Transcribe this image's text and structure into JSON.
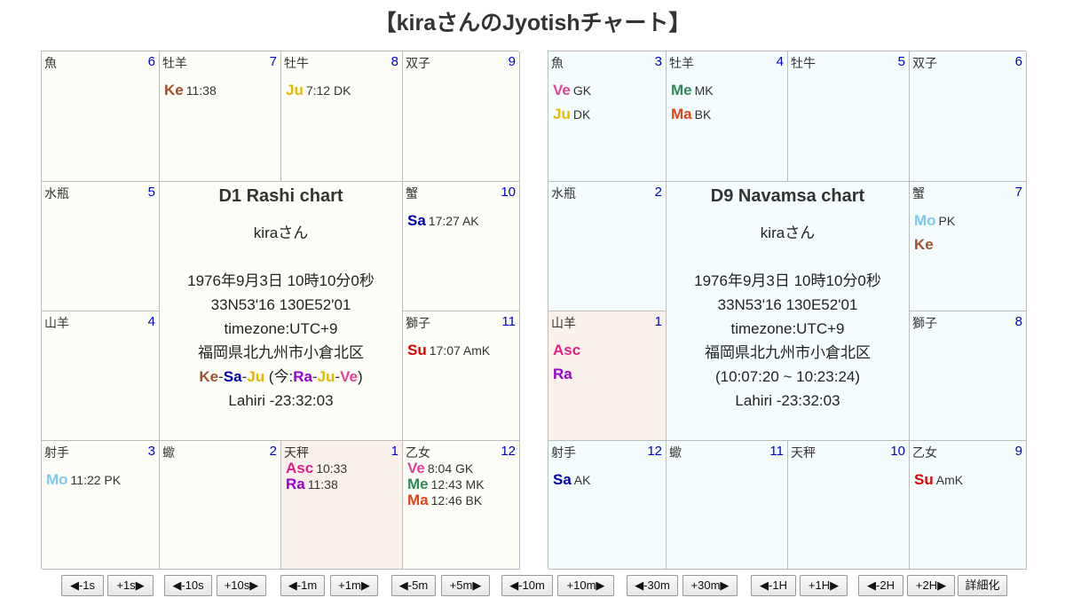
{
  "title": "【kiraさんのJyotishチャート】",
  "charts": [
    {
      "id": "d1",
      "title": "D1 Rashi chart",
      "name": "kiraさん",
      "datetime": "1976年9月3日 10時10分0秒",
      "coords": "33N53'16 130E52'01",
      "timezone": "timezone:UTC+9",
      "place": "福岡県北九州市小倉北区",
      "extra_line": "",
      "dasha": {
        "main": [
          {
            "t": "Ke",
            "c": "#a0522d"
          },
          {
            "t": "-",
            "c": "#333333"
          },
          {
            "t": "Sa",
            "c": "#0000aa"
          },
          {
            "t": "-",
            "c": "#333333"
          },
          {
            "t": "Ju",
            "c": "#e6b800"
          }
        ],
        "now_prefix": " (今:",
        "now": [
          {
            "t": "Ra",
            "c": "#9900cc"
          },
          {
            "t": "-",
            "c": "#333333"
          },
          {
            "t": "Ju",
            "c": "#e6b800"
          },
          {
            "t": "-",
            "c": "#333333"
          },
          {
            "t": "Ve",
            "c": "#e0449a"
          }
        ],
        "now_suffix": ")"
      },
      "ayanamsa": "Lahiri -23:32:03",
      "cells": [
        {
          "sign": "魚",
          "house": "6",
          "planets": []
        },
        {
          "sign": "牡羊",
          "house": "7",
          "planets": [
            {
              "abbr": "Ke",
              "color": "#a0522d",
              "info": "11:38"
            }
          ]
        },
        {
          "sign": "牡牛",
          "house": "8",
          "planets": [
            {
              "abbr": "Ju",
              "color": "#e6b800",
              "info": "7:12 DK"
            }
          ]
        },
        {
          "sign": "双子",
          "house": "9",
          "planets": []
        },
        {
          "sign": "蟹",
          "house": "10",
          "planets": [
            {
              "abbr": "Sa",
              "color": "#0000aa",
              "info": "17:27 AK"
            }
          ]
        },
        {
          "sign": "獅子",
          "house": "11",
          "planets": [
            {
              "abbr": "Su",
              "color": "#e00000",
              "info": "17:07 AmK"
            }
          ]
        },
        {
          "sign": "乙女",
          "house": "12",
          "planets": [
            {
              "abbr": "Ve",
              "color": "#e0449a",
              "info": "8:04 GK"
            },
            {
              "abbr": "Me",
              "color": "#2e8b57",
              "info": "12:43 MK"
            },
            {
              "abbr": "Ma",
              "color": "#e0441a",
              "info": "12:46 BK"
            }
          ]
        },
        {
          "sign": "天秤",
          "house": "1",
          "planets": [
            {
              "abbr": "Asc",
              "color": "#e0208a",
              "info": "10:33"
            },
            {
              "abbr": "Ra",
              "color": "#9900cc",
              "info": "11:38"
            }
          ]
        },
        {
          "sign": "蠍",
          "house": "2",
          "planets": []
        },
        {
          "sign": "射手",
          "house": "3",
          "planets": [
            {
              "abbr": "Mo",
              "color": "#7ec8f0",
              "info": "11:22 PK"
            }
          ]
        },
        {
          "sign": "山羊",
          "house": "4",
          "planets": []
        },
        {
          "sign": "水瓶",
          "house": "5",
          "planets": []
        }
      ]
    },
    {
      "id": "d9",
      "title": "D9 Navamsa chart",
      "name": "kiraさん",
      "datetime": "1976年9月3日 10時10分0秒",
      "coords": "33N53'16 130E52'01",
      "timezone": "timezone:UTC+9",
      "place": "福岡県北九州市小倉北区",
      "extra_line": "(10:07:20 ~ 10:23:24)",
      "ayanamsa": "Lahiri -23:32:03",
      "cells": [
        {
          "sign": "魚",
          "house": "3",
          "planets": [
            {
              "abbr": "Ve",
              "color": "#e0449a",
              "info": "GK"
            },
            {
              "abbr": "Ju",
              "color": "#e6b800",
              "info": "DK"
            }
          ]
        },
        {
          "sign": "牡羊",
          "house": "4",
          "planets": [
            {
              "abbr": "Me",
              "color": "#2e8b57",
              "info": "MK"
            },
            {
              "abbr": "Ma",
              "color": "#e0441a",
              "info": "BK"
            }
          ]
        },
        {
          "sign": "牡牛",
          "house": "5",
          "planets": []
        },
        {
          "sign": "双子",
          "house": "6",
          "planets": []
        },
        {
          "sign": "蟹",
          "house": "7",
          "planets": [
            {
              "abbr": "Mo",
              "color": "#7ec8f0",
              "info": "PK"
            },
            {
              "abbr": "Ke",
              "color": "#a0522d",
              "info": ""
            }
          ]
        },
        {
          "sign": "獅子",
          "house": "8",
          "planets": []
        },
        {
          "sign": "乙女",
          "house": "9",
          "planets": [
            {
              "abbr": "Su",
              "color": "#e00000",
              "info": "AmK"
            }
          ]
        },
        {
          "sign": "天秤",
          "house": "10",
          "planets": []
        },
        {
          "sign": "蠍",
          "house": "11",
          "planets": []
        },
        {
          "sign": "射手",
          "house": "12",
          "planets": [
            {
              "abbr": "Sa",
              "color": "#0000aa",
              "info": "AK"
            }
          ]
        },
        {
          "sign": "山羊",
          "house": "1",
          "planets": [
            {
              "abbr": "Asc",
              "color": "#e0208a",
              "info": ""
            },
            {
              "abbr": "Ra",
              "color": "#9900cc",
              "info": ""
            }
          ]
        },
        {
          "sign": "水瓶",
          "house": "2",
          "planets": []
        }
      ]
    }
  ],
  "buttons": [
    "◀-1s",
    "+1s▶",
    "◀-10s",
    "+10s▶",
    "◀-1m",
    "+1m▶",
    "◀-5m",
    "+5m▶",
    "◀-10m",
    "+10m▶",
    "◀-30m",
    "+30m▶",
    "◀-1H",
    "+1H▶",
    "◀-2H",
    "+2H▶",
    "詳細化"
  ]
}
